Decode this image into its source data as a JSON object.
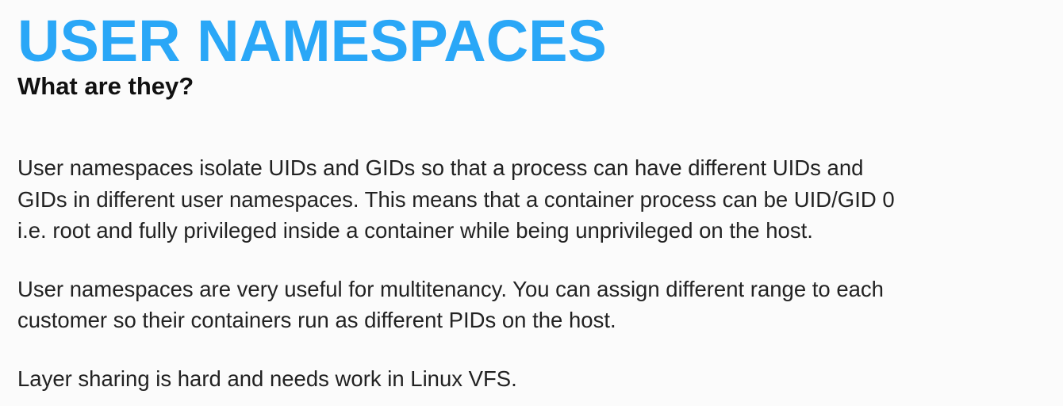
{
  "slide": {
    "title": "USER NAMESPACES",
    "subtitle": "What are they?",
    "paragraphs": [
      {
        "lines": [
          "User namespaces isolate UIDs and GIDs so that a process can have different UIDs and",
          "GIDs in different user namespaces. This means that a container process can be UID/GID 0",
          "i.e. root and fully privileged inside a container while being unprivileged on the host."
        ]
      },
      {
        "lines": [
          "User namespaces are very useful for multitenancy. You can assign different range to each",
          "customer so their containers run as different PIDs on the host."
        ]
      },
      {
        "lines": [
          "Layer sharing is hard and needs work in Linux VFS."
        ]
      }
    ],
    "colors": {
      "title": "#2aa7f7",
      "subtitle": "#111111",
      "body_text": "#222222",
      "background": "#fbfbfb"
    }
  }
}
